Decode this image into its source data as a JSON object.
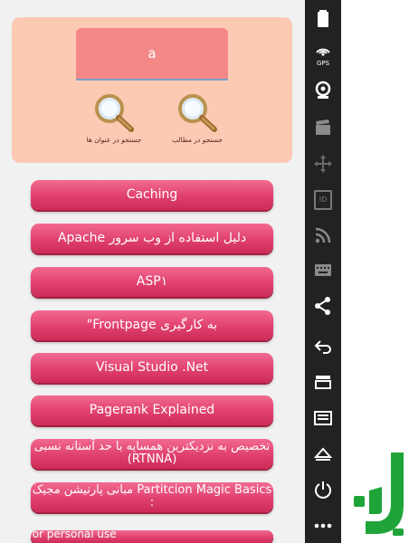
{
  "search": {
    "query": "a",
    "buttons": [
      {
        "label": "جستجو در مطالب",
        "icon": "magnifier-icon"
      },
      {
        "label": "جستجو در عنوان ها",
        "icon": "magnifier-icon"
      }
    ]
  },
  "menu": {
    "items": [
      {
        "label": "Caching"
      },
      {
        "label": "دلیل استفاده از وب سرور Apache"
      },
      {
        "label": "ASP۱"
      },
      {
        "label": "به کارگیری Frontpage\""
      },
      {
        "label": "Visual Studio .Net"
      },
      {
        "label": "Pagerank  Explained"
      },
      {
        "label": "تخصیص به نزدیکترین همسایه با حد آستانه نسبی (RTNNA)"
      },
      {
        "label": "Partitcion Magic Basics مبانی پارتیشن مجیک :"
      }
    ]
  },
  "watermark": "free for personal use",
  "nav_bar": {
    "icons": [
      "battery-icon",
      "gps-icon",
      "camera-icon",
      "clapperboard-icon",
      "move-icon",
      "id-icon",
      "rss-icon",
      "keyboard-icon",
      "share-icon",
      "back-icon",
      "recent-apps-icon",
      "menu-icon",
      "home-icon",
      "power-icon",
      "more-icon"
    ],
    "gps_label": "GPS",
    "id_label": "ID"
  },
  "colors": {
    "card": "#fcc9b3",
    "input": "#f48888",
    "button": "#e0406d",
    "nav": "#222222",
    "logo": "#1fa43a"
  }
}
